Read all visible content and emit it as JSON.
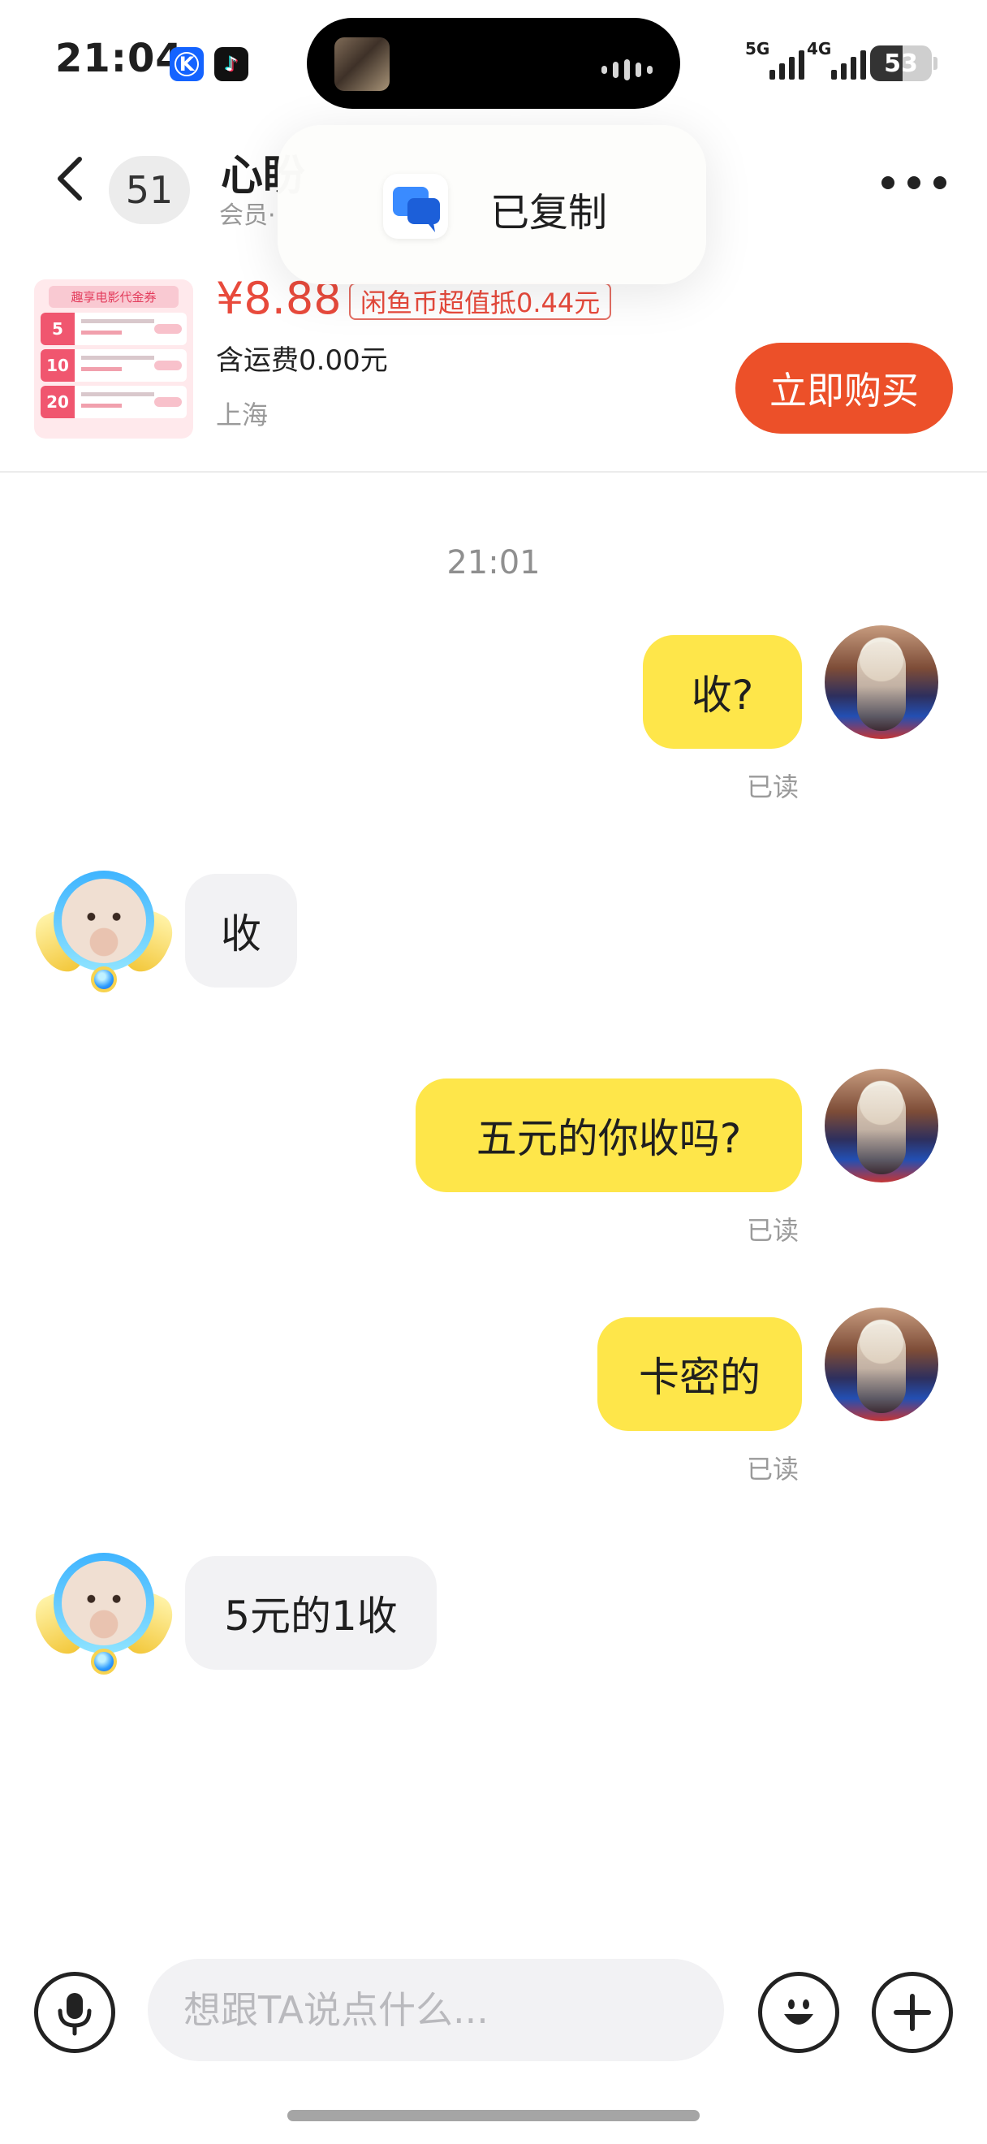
{
  "status_bar": {
    "time": "21:04",
    "network_5g": "5G",
    "network_4g": "4G",
    "battery_percent": "53",
    "battery_level": 0.53
  },
  "chat_header": {
    "unread_count": "51",
    "contact_name": "心盼",
    "contact_subtitle": "会员·"
  },
  "toast": {
    "label": "已复制"
  },
  "product": {
    "thumb_title": "趣享电影代金券",
    "thumb_tags": [
      "5",
      "10",
      "20"
    ],
    "price": "¥8.88",
    "coin_discount": "闲鱼币超值抵0.44元",
    "shipping": "含运费0.00元",
    "location": "上海",
    "buy_button": "立即购买"
  },
  "chat": {
    "timestamp": "21:01",
    "messages": [
      {
        "sender": "me",
        "text": "收?",
        "status": "已读"
      },
      {
        "sender": "them",
        "text": "收"
      },
      {
        "sender": "me",
        "text": "五元的你收吗?",
        "status": "已读"
      },
      {
        "sender": "me",
        "text": "卡密的",
        "status": "已读"
      },
      {
        "sender": "them",
        "text": "5元的1收"
      }
    ]
  },
  "input_bar": {
    "placeholder": "想跟TA说点什么..."
  },
  "colors": {
    "my_bubble": "#fee64a",
    "their_bubble": "#f2f2f4",
    "price_red": "#e84a3c",
    "buy_button": "#ec5029"
  },
  "icons": [
    "back-icon",
    "more-icon",
    "copy-app-icon",
    "mic-icon",
    "emoji-icon",
    "plus-icon"
  ]
}
